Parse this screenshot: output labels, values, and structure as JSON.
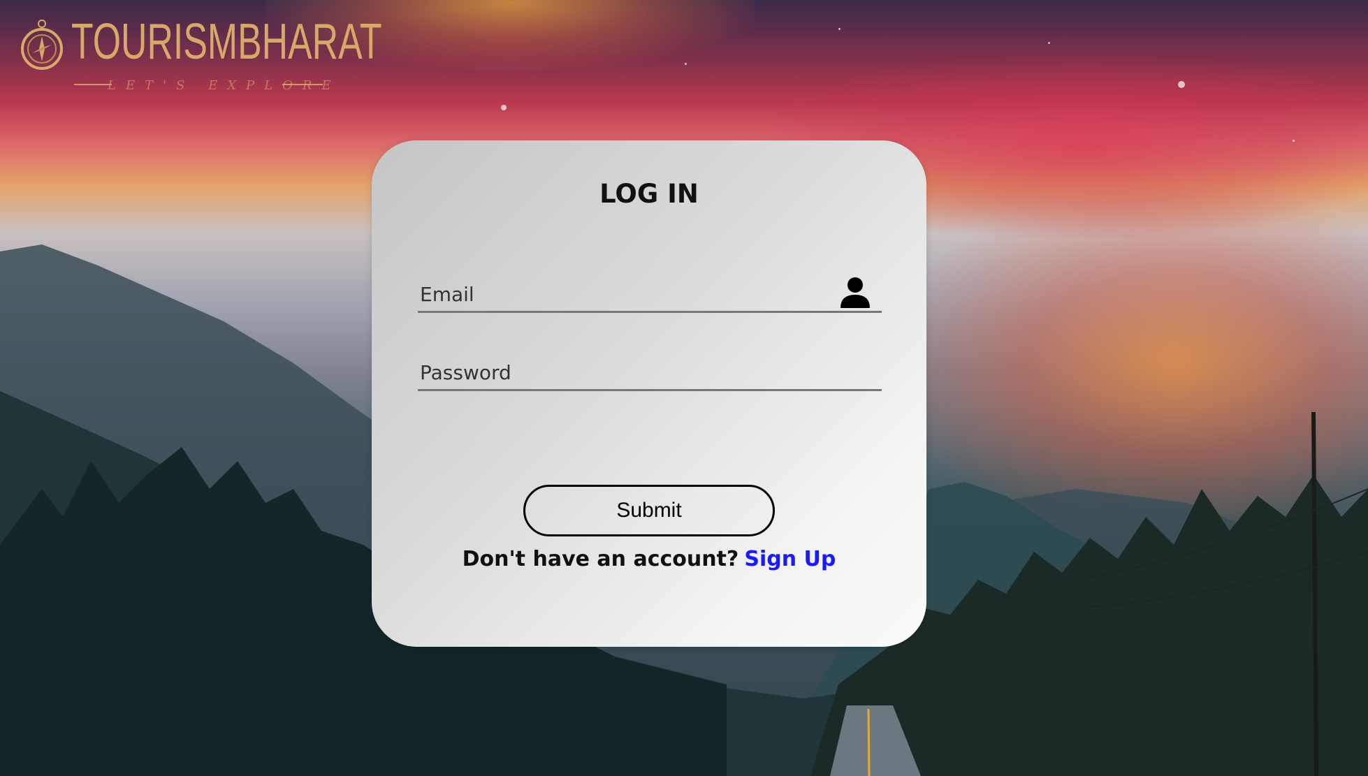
{
  "brand": {
    "name": "TOURISMBHARAT",
    "tagline": "LET'S EXPLORE"
  },
  "login": {
    "title": "LOG IN",
    "email_placeholder": "Email",
    "password_placeholder": "Password",
    "submit_label": "Submit",
    "signup_prompt": "Don't have an account?",
    "signup_link": "Sign Up"
  },
  "icons": {
    "compass": "compass-icon",
    "user": "user-icon"
  },
  "colors": {
    "accent_gold": "#d7a86a",
    "link_blue": "#1a1aff",
    "card_bg": "#e5e5e5"
  }
}
